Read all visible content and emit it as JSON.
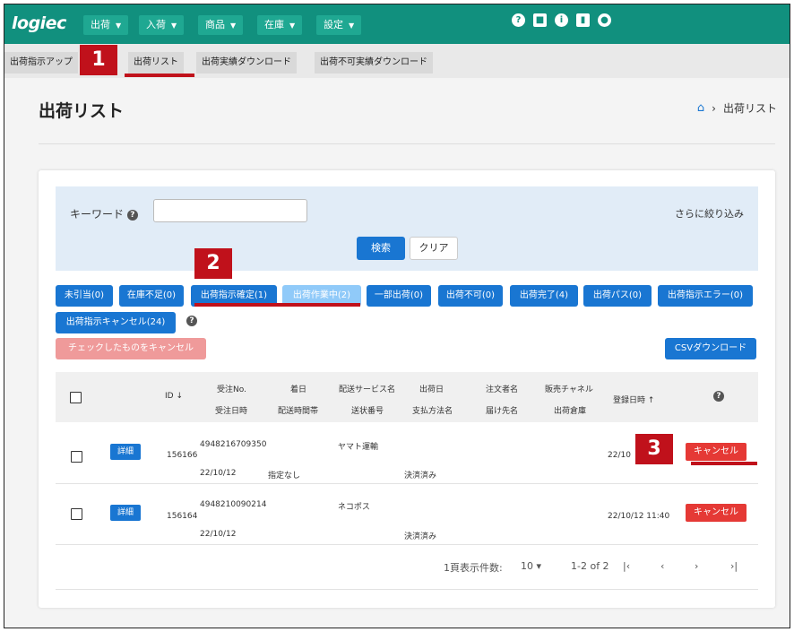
{
  "nav": {
    "logo": "logiec",
    "menus": [
      "出荷",
      "入荷",
      "商品",
      "在庫",
      "設定"
    ],
    "icons": [
      "help-icon",
      "briefcase-icon",
      "info-icon",
      "chart-icon",
      "user-icon"
    ]
  },
  "subnav": {
    "tabs": [
      "出荷指示アップ",
      "出荷リスト",
      "出荷実績ダウンロード",
      "出荷不可実績ダウンロード"
    ]
  },
  "badges": [
    "1",
    "2",
    "3"
  ],
  "page": {
    "title": "出荷リスト",
    "breadcrumb": "出荷リスト"
  },
  "search": {
    "keyword_label": "キーワード",
    "keyword_value": "",
    "more_filters": "さらに絞り込み",
    "search_btn": "検索",
    "clear_btn": "クリア"
  },
  "filters": [
    "未引当(0)",
    "在庫不足(0)",
    "出荷指示確定(1)",
    "出荷作業中(2)",
    "一部出荷(0)",
    "出荷不可(0)",
    "出荷完了(4)",
    "出荷パス(0)",
    "出荷指示エラー(0)",
    "出荷指示キャンセル(24)"
  ],
  "actions": {
    "cancel_checked": "チェックしたものをキャンセル",
    "csv_download": "CSVダウンロード"
  },
  "table": {
    "headers": {
      "id": "ID",
      "order_no": "受注No.",
      "order_date": "受注日時",
      "arrival": "着日",
      "delivery_slot": "配送時間帯",
      "delivery_service": "配送サービス名",
      "tracking_no": "送状番号",
      "ship_date": "出荷日",
      "payment": "支払方法名",
      "customer": "注文者名",
      "recipient": "届け先名",
      "channel": "販売チャネル",
      "warehouse": "出荷倉庫",
      "registered": "登録日時"
    },
    "rows": [
      {
        "detail": "詳細",
        "id": "156166",
        "order_no": "4948216709350",
        "order_date": "22/10/12",
        "slot": "指定なし",
        "service": "ヤマト運輸",
        "payment": "決済済み",
        "registered": "22/10",
        "cancel": "キャンセル"
      },
      {
        "detail": "詳細",
        "id": "156164",
        "order_no": "4948210090214",
        "order_date": "22/10/12",
        "slot": "",
        "service": "ネコポス",
        "payment": "決済済み",
        "registered": "22/10/12 11:40",
        "cancel": "キャンセル"
      }
    ]
  },
  "pagination": {
    "per_page_label": "1頁表示件数:",
    "per_page": "10",
    "range": "1-2 of 2"
  }
}
